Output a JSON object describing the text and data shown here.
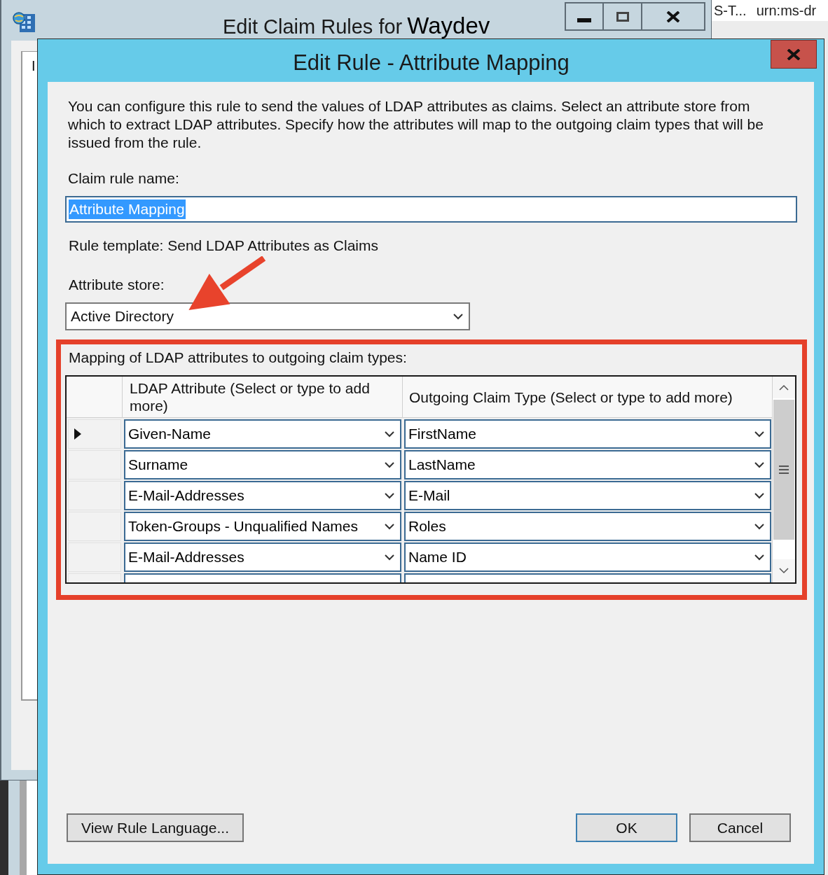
{
  "background_window": {
    "title": "Edit Claim Rules for",
    "title_name": "Waydev",
    "tab_label": "I",
    "list_row": {
      "cells": [
        "S-T...",
        "urn:ms-dr"
      ]
    }
  },
  "dialog": {
    "title": "Edit Rule - Attribute Mapping"
  },
  "description": "You can configure this rule to send the values of LDAP attributes as claims. Select an attribute store from which to extract LDAP attributes. Specify how the attributes will map to the outgoing claim types that will be issued from the rule.",
  "rule_name": {
    "label": "Claim rule name:",
    "value": "Attribute Mapping",
    "text_selected": true
  },
  "rule_template": "Rule template: Send LDAP Attributes as Claims",
  "attribute_store": {
    "label": "Attribute store:",
    "value": "Active Directory"
  },
  "mapping": {
    "label": "Mapping of LDAP attributes to outgoing claim types:",
    "highlighted": true,
    "columns": [
      "LDAP Attribute (Select or type to add more)",
      "Outgoing Claim Type (Select or type to add more)"
    ],
    "rows": [
      {
        "ldap_attribute": "Given-Name",
        "claim_type": "FirstName",
        "current": true
      },
      {
        "ldap_attribute": "Surname",
        "claim_type": "LastName",
        "current": false
      },
      {
        "ldap_attribute": "E-Mail-Addresses",
        "claim_type": "E-Mail",
        "current": false
      },
      {
        "ldap_attribute": "Token-Groups - Unqualified Names",
        "claim_type": "Roles",
        "current": false
      },
      {
        "ldap_attribute": "E-Mail-Addresses",
        "claim_type": "Name ID",
        "current": false
      }
    ],
    "new_row": true
  },
  "footer": {
    "left_buttons": [
      {
        "label": "View Rule Language...",
        "default": false
      }
    ],
    "right_buttons": [
      {
        "label": "OK",
        "default": true
      },
      {
        "label": "Cancel",
        "default": false
      }
    ]
  }
}
